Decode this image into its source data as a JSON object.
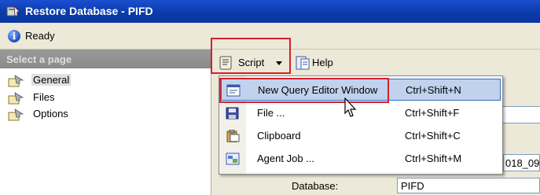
{
  "window": {
    "title": "Restore Database - PIFD",
    "title_icon": "restore-database-icon"
  },
  "status": {
    "text": "Ready",
    "icon": "info-icon"
  },
  "left_pane": {
    "header": "Select a page",
    "items": [
      {
        "label": "General",
        "icon": "page-icon",
        "selected": true
      },
      {
        "label": "Files",
        "icon": "page-icon",
        "selected": false
      },
      {
        "label": "Options",
        "icon": "page-icon",
        "selected": false
      }
    ]
  },
  "toolbar": {
    "script_label": "Script",
    "script_icon": "script-icon",
    "dropdown_icon": "chevron-down-icon",
    "help_label": "Help",
    "help_icon": "help-icon"
  },
  "script_menu": {
    "items": [
      {
        "label": "New Query Editor Window",
        "shortcut": "Ctrl+Shift+N",
        "icon": "query-window-icon",
        "highlighted": true
      },
      {
        "label": "File ...",
        "shortcut": "Ctrl+Shift+F",
        "icon": "save-file-icon",
        "highlighted": false
      },
      {
        "label": "Clipboard",
        "shortcut": "Ctrl+Shift+C",
        "icon": "clipboard-icon",
        "highlighted": false
      },
      {
        "label": "Agent Job ...",
        "shortcut": "Ctrl+Shift+M",
        "icon": "agent-job-icon",
        "highlighted": false
      }
    ]
  },
  "form": {
    "database_label": "Database:",
    "database_value": "PIFD",
    "partial_field_value": "018_09"
  },
  "colors": {
    "title_bar": "#0a3aa8",
    "highlight": "#c1d2ee",
    "annotation_red": "#d6202b",
    "panel": "#ece9d8"
  }
}
